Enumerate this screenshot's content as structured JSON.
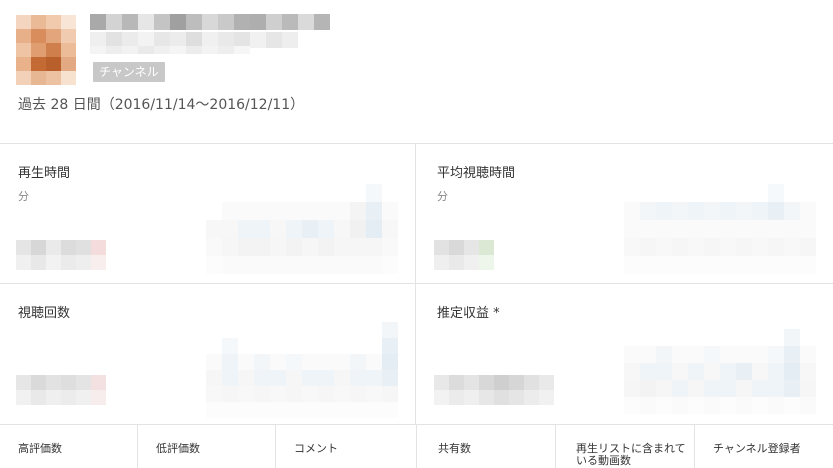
{
  "header": {
    "channel_badge": "チャンネル",
    "date_range": "過去 28 日間（2016/11/14〜2016/12/11）",
    "colors": {
      "badge_bg": "#c8c8c8",
      "border": "#e3e3e3"
    }
  },
  "metrics": {
    "watch_time": {
      "title": "再生時間",
      "unit": "分"
    },
    "avg_view_duration": {
      "title": "平均視聴時間",
      "unit": "分"
    },
    "views": {
      "title": "視聴回数"
    },
    "estimated_revenue": {
      "title": "推定収益 *"
    }
  },
  "bottom": {
    "likes": "高評価数",
    "dislikes": "低評価数",
    "comments": "コメント",
    "shares": "共有数",
    "in_playlists": "再生リストに含まれている動画数",
    "subscribers": "チャンネル登録者"
  }
}
